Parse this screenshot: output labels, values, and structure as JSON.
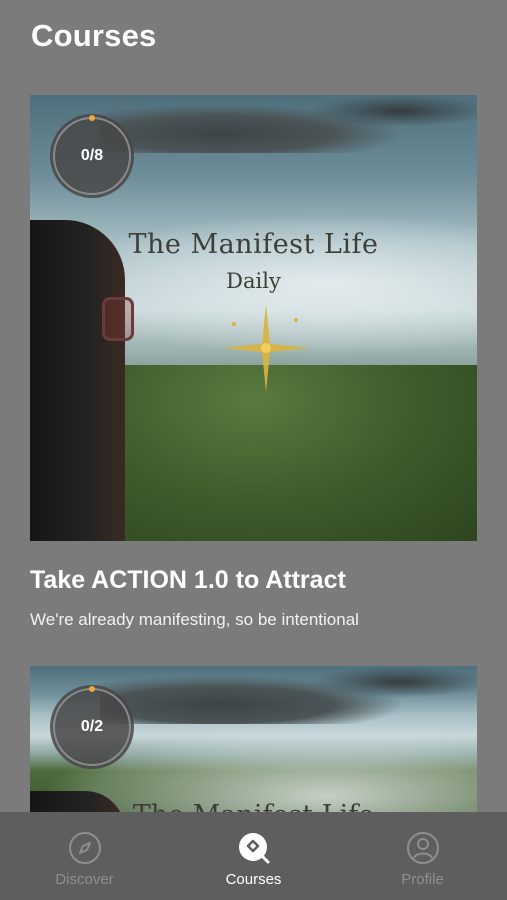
{
  "header": {
    "title": "Courses"
  },
  "courses": [
    {
      "progress": "0/8",
      "progress_fraction": 0.0,
      "image_text_main": "The Manifest Life",
      "image_text_sub": "Daily",
      "title": "Take ACTION 1.0 to Attract",
      "description": "We're already manifesting, so be intentional"
    },
    {
      "progress": "0/2",
      "progress_fraction": 0.0,
      "image_text_main": "The Manifest Life"
    }
  ],
  "tabs": [
    {
      "label": "Discover",
      "icon": "compass-icon",
      "active": false
    },
    {
      "label": "Courses",
      "icon": "courses-search-icon",
      "active": true
    },
    {
      "label": "Profile",
      "icon": "profile-icon",
      "active": false
    }
  ],
  "colors": {
    "accent": "#f2a93b",
    "tab_active": "#ffffff",
    "tab_inactive": "#8f8f8f"
  }
}
